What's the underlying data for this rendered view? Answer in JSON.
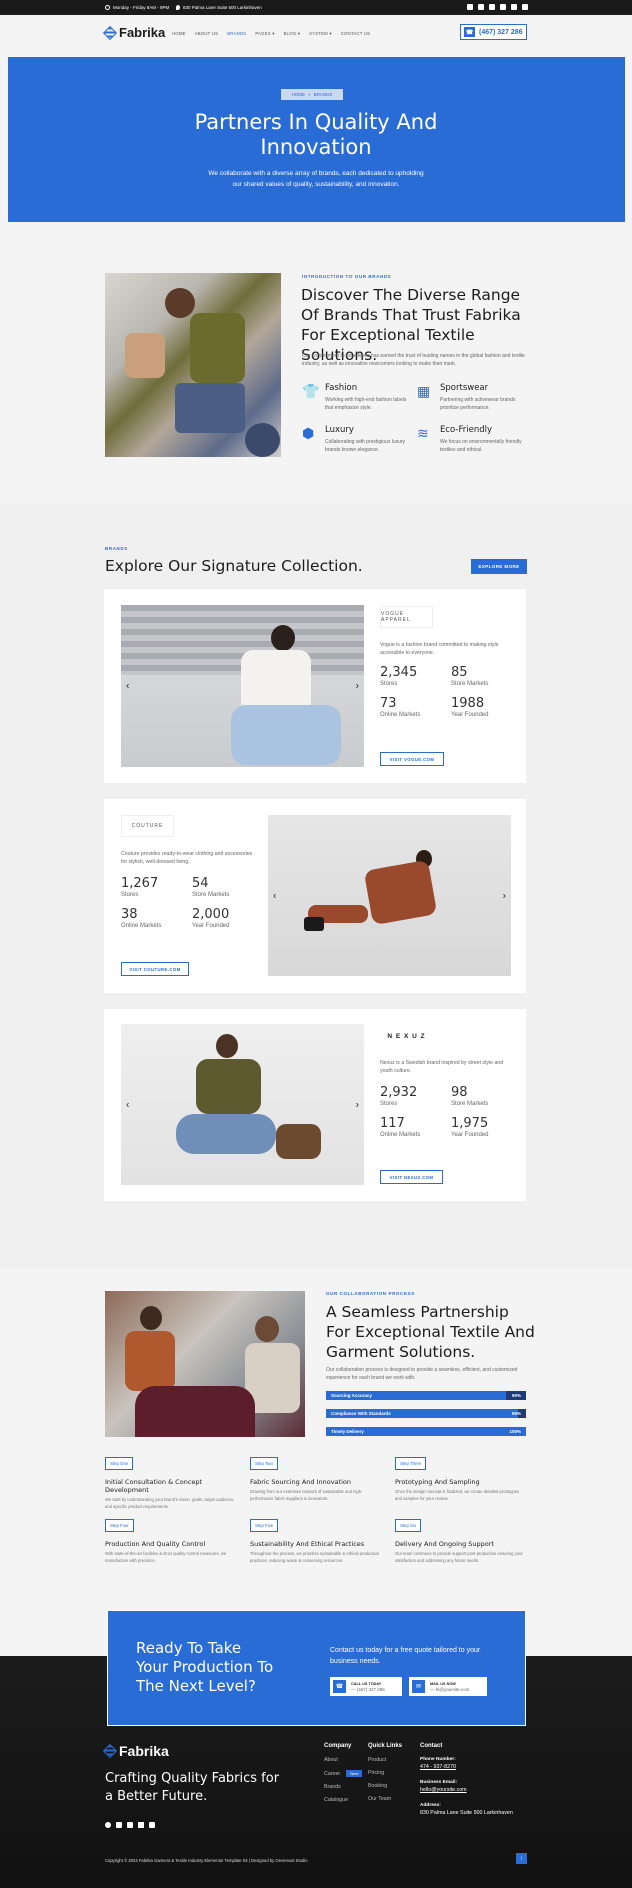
{
  "topbar": {
    "hours": "Monday - Friday 8AM - 9PM",
    "address": "830 Palma Lane Suite 500 Larkinhaven"
  },
  "nav": {
    "logo": "Fabrika",
    "items": [
      "HOME",
      "ABOUT US",
      "BRANDS",
      "PAGES ▾",
      "BLOG ▾",
      "SYSTEM ▾",
      "CONTACT US"
    ],
    "phone": "(467) 327 286"
  },
  "hero": {
    "crumb_home": "HOME",
    "crumb_sep": "»",
    "crumb_current": "BRANDS",
    "title": "Partners In Quality And Innovation",
    "subtitle": "We collaborate with a diverse array of brands, each dedicated to upholding our shared values of quality, sustainability, and innovation."
  },
  "intro": {
    "label": "INTRODUCTION TO OUR BRANDS",
    "title": "Discover The Diverse Range Of Brands That Trust Fabrika For Exceptional Textile Solutions.",
    "text": "Our commitment to excellence has earned the trust of leading names in the global fashion and textile industry, as well as innovative newcomers looking to make their mark.",
    "features": [
      {
        "title": "Fashion",
        "text": "Working with high-end fashion labels that emphasize style."
      },
      {
        "title": "Sportswear",
        "text": "Partnering with activewear brands prioritize performance."
      },
      {
        "title": "Luxury",
        "text": "Collaborating with prestigious luxury brands known elegance."
      },
      {
        "title": "Eco-Friendly",
        "text": "We focus on environmentally friendly textiles and ethical."
      }
    ]
  },
  "brands": {
    "label": "BRANDS",
    "title": "Explore Our Signature Collection.",
    "explore_btn": "EXPLORE MORE",
    "cards": [
      {
        "logo": "VOGUE APPAREL",
        "desc": "Vogue is a fashion brand committed to making style accessible to everyone.",
        "stats": [
          {
            "n": "2,345",
            "l": "Stores"
          },
          {
            "n": "85",
            "l": "Store Markets"
          },
          {
            "n": "73",
            "l": "Online Markets"
          },
          {
            "n": "1988",
            "l": "Year Founded"
          }
        ],
        "btn": "VISIT VOGUE.COM"
      },
      {
        "logo": "COUTURE",
        "desc": "Couture provides ready-to-wear clothing and accessories for stylish, well-dressed living.",
        "stats": [
          {
            "n": "1,267",
            "l": "Stores"
          },
          {
            "n": "54",
            "l": "Store Markets"
          },
          {
            "n": "38",
            "l": "Online Markets"
          },
          {
            "n": "2,000",
            "l": "Year Founded"
          }
        ],
        "btn": "VISIT COUTURE.COM"
      },
      {
        "logo": "N E X U Z",
        "desc": "Nexuz is a Swedish brand inspired by street style and youth culture.",
        "stats": [
          {
            "n": "2,932",
            "l": "Stores"
          },
          {
            "n": "98",
            "l": "Store Markets"
          },
          {
            "n": "117",
            "l": "Online Markets"
          },
          {
            "n": "1,975",
            "l": "Year Founded"
          }
        ],
        "btn": "VISIT NEXUZ.COM"
      }
    ]
  },
  "collab": {
    "label": "OUR COLLABORATION PROCESS",
    "title": "A Seamless Partnership For Exceptional Textile And Garment Solutions.",
    "text": "Our collaboration process is designed to provide a seamless, efficient, and customized experience for each brand we work with.",
    "bars": [
      {
        "label": "Sourcing Accuracy",
        "value": "90%",
        "pct": 0.9
      },
      {
        "label": "Compliance With Standards",
        "value": "96%",
        "pct": 0.96
      },
      {
        "label": "Timely Delivery",
        "value": "100%",
        "pct": 1.0
      }
    ],
    "steps": [
      {
        "tag": "Step One",
        "title": "Initial Consultation & Concept Development",
        "text": "We start by understanding your brand's vision, goals, target audience, and specific product requirements."
      },
      {
        "tag": "Step Two",
        "title": "Fabric Sourcing And Innovation",
        "text": "Drawing from our extensive network of sustainable and high-performance fabric suppliers & innovators."
      },
      {
        "tag": "Step Three",
        "title": "Prototyping And Sampling",
        "text": "Once the design concept is finalized, we create detailed prototypes and samples for your review."
      },
      {
        "tag": "Step Four",
        "title": "Production And Quality Control",
        "text": "With state-of-the-art facilities & strict quality control measures, we manufacture with precision."
      },
      {
        "tag": "Step Five",
        "title": "Sustainability And Ethical Practices",
        "text": "Throughout the process, we prioritize sustainable & ethical production practices, reducing waste & conserving resources."
      },
      {
        "tag": "Step Six",
        "title": "Delivery And Ongoing Support",
        "text": "Our team continues to provide support post-production ensuring your satisfaction and addressing any future needs."
      }
    ]
  },
  "cta": {
    "title": "Ready To Take Your Production To The Next Level?",
    "text": "Contact us today for a free quote tailored to your business needs.",
    "call_label": "CALL US TODAY",
    "call_value": "— (467) 327 286",
    "mail_label": "MAIL US NOW",
    "mail_value": "— hi@yoursite.com"
  },
  "footer": {
    "logo": "Fabrika",
    "tagline": "Crafting Quality Fabrics for a Better Future.",
    "company_title": "Company",
    "company": [
      "About",
      "Career",
      "Brands",
      "Catalogue"
    ],
    "new_badge": "New",
    "links_title": "Quick Links",
    "links": [
      "Product",
      "Pricing",
      "Booking",
      "Our Team"
    ],
    "contact_title": "Contact",
    "phone_label": "Phone Number:",
    "phone": "474 - 937-8270",
    "email_label": "Business Email:",
    "email": "hello@yoursite.com",
    "address_label": "Address:",
    "address": "830 Palma Lane Suite 500 Larkinhaven",
    "copyright": "Copyright © 2024 Fabrika Garment & Textile Industry Elementor Template Kit | Designed by Oevervust Studio"
  }
}
